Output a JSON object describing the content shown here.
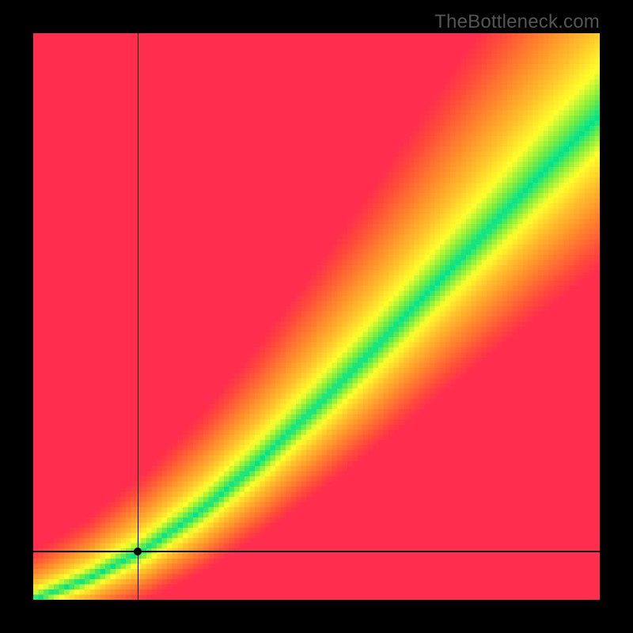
{
  "watermark": "TheBottleneck.com",
  "chart_data": {
    "type": "heatmap",
    "title": "",
    "xlabel": "",
    "ylabel": "",
    "xlim": [
      0,
      1
    ],
    "ylim": [
      0,
      1
    ],
    "legend": "none",
    "grid": false,
    "description": "2D compatibility/bottleneck map. Color encodes match quality: green along the optimal curve (best match), fading through yellow to orange/red (worst) as distance from the curve increases. A black crosshair marks a selected point near the lower-left of the plot.",
    "marker": {
      "x": 0.185,
      "y": 0.085
    },
    "optimal_curve_approx": [
      {
        "x": 0.0,
        "y": 0.0
      },
      {
        "x": 0.1,
        "y": 0.038
      },
      {
        "x": 0.2,
        "y": 0.09
      },
      {
        "x": 0.3,
        "y": 0.16
      },
      {
        "x": 0.4,
        "y": 0.245
      },
      {
        "x": 0.5,
        "y": 0.34
      },
      {
        "x": 0.6,
        "y": 0.44
      },
      {
        "x": 0.7,
        "y": 0.545
      },
      {
        "x": 0.8,
        "y": 0.65
      },
      {
        "x": 0.9,
        "y": 0.755
      },
      {
        "x": 1.0,
        "y": 0.855
      }
    ],
    "color_stops": [
      {
        "t": 0.0,
        "hex": "#00e38f"
      },
      {
        "t": 0.1,
        "hex": "#7ded3f"
      },
      {
        "t": 0.22,
        "hex": "#ffff2c"
      },
      {
        "t": 0.4,
        "hex": "#ffc02c"
      },
      {
        "t": 0.6,
        "hex": "#ff8a2c"
      },
      {
        "t": 0.85,
        "hex": "#ff4a3a"
      },
      {
        "t": 1.0,
        "hex": "#ff2d4e"
      }
    ],
    "pixel_resolution": 110
  },
  "colors": {
    "frame": "#000000",
    "watermark": "#555555"
  }
}
